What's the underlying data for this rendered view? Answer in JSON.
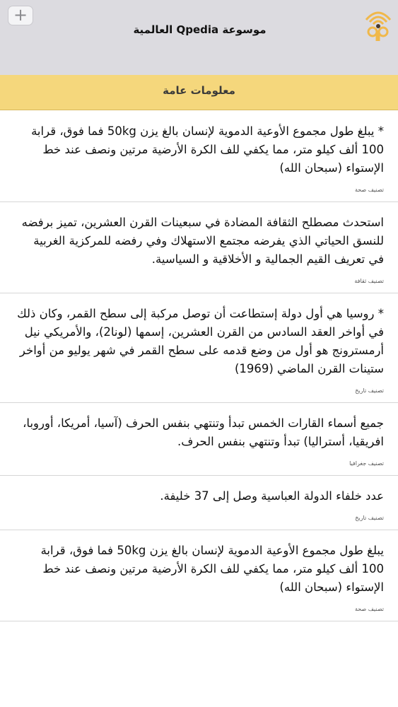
{
  "header": {
    "app_title": "موسوعة Qpedia العالمية",
    "add_icon_glyph": "+",
    "brand_color": "#f0b84b"
  },
  "section": {
    "title": "معلومات عامة"
  },
  "posts": [
    {
      "text": "* يبلغ طول مجموع الأوعية الدموية لإنسان بالغ يزن 50kg فما فوق، قرابة 100 ألف كيلو متر، مما يكفي للف الكرة الأرضية مرتين ونصف عند خط الإستواء (سبحان الله)",
      "category": "تصنيف صحة"
    },
    {
      "text": "استحدث مصطلح الثقافة المضادة في سبعينات القرن العشرين، تميز برفضه للنسق الحياتي الذي يفرضه مجتمع الاستهلاك وفي رفضه للمركزية الغربية في تعريف القيم الجمالية و الأخلاقية و السياسية.",
      "category": "تصنيف ثقافة"
    },
    {
      "text": "* روسيا هي أول دولة إستطاعت أن توصل مركبة إلى سطح القمر، وكان ذلك في أواخر العقد السادس من القرن العشرين، إسمها (لونا2)، والأمريكي نيل أرمسترونج هو أول من وضع قدمه على سطح القمر في شهر يوليو من أواخر ستينات القرن الماضي (1969)",
      "category": "تصنيف تاريخ"
    },
    {
      "text": "جميع أسماء القارات الخمس تبدأ وتنتهي بنفس الحرف (آسيا، أمريكا، أوروبا، افريقيا، أستراليا) تبدأ وتنتهي بنفس الحرف.",
      "category": "تصنيف جغرافيا"
    },
    {
      "text": "عدد خلفاء الدولة العباسية وصل إلى 37 خليفة.",
      "category": "تصنيف تاريخ"
    },
    {
      "text": "يبلغ طول مجموع الأوعية الدموية لإنسان بالغ يزن 50kg فما فوق، قرابة 100 ألف كيلو متر، مما يكفي للف الكرة الأرضية مرتين ونصف عند خط الإستواء (سبحان الله)",
      "category": "تصنيف صحة"
    }
  ]
}
